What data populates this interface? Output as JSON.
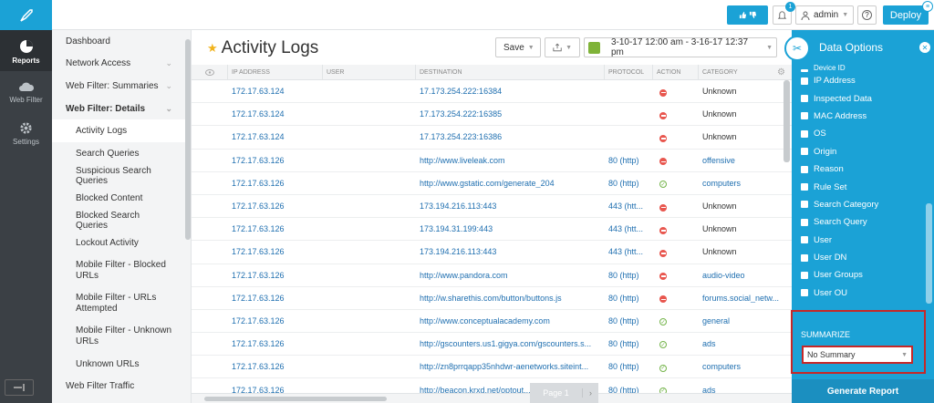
{
  "rail": {
    "items": [
      {
        "label": "Reports",
        "icon": "pie-chart-icon"
      },
      {
        "label": "Web Filter",
        "icon": "cloud-icon"
      },
      {
        "label": "Settings",
        "icon": "gear-icon"
      }
    ]
  },
  "topbar": {
    "notifications_count": "1",
    "user": "admin",
    "help": "?",
    "deploy": "Deploy"
  },
  "nav": {
    "items": [
      {
        "label": "Dashboard",
        "type": "top"
      },
      {
        "label": "Network Access",
        "type": "top",
        "chevron": true
      },
      {
        "label": "Web Filter: Summaries",
        "type": "top",
        "chevron": true
      },
      {
        "label": "Web Filter: Details",
        "type": "top-bold",
        "chevron": true
      },
      {
        "label": "Activity Logs",
        "type": "sub-active"
      },
      {
        "label": "Search Queries",
        "type": "sub"
      },
      {
        "label": "Suspicious Search Queries",
        "type": "sub"
      },
      {
        "label": "Blocked Content",
        "type": "sub"
      },
      {
        "label": "Blocked Search Queries",
        "type": "sub"
      },
      {
        "label": "Lockout Activity",
        "type": "sub"
      },
      {
        "label": "Mobile Filter - Blocked URLs",
        "type": "sub-two"
      },
      {
        "label": "Mobile Filter - URLs Attempted",
        "type": "sub-two"
      },
      {
        "label": "Mobile Filter - Unknown URLs",
        "type": "sub-two"
      },
      {
        "label": "Unknown URLs",
        "type": "sub"
      },
      {
        "label": "Web Filter Traffic",
        "type": "top"
      }
    ]
  },
  "main": {
    "title": "Activity Logs",
    "save": "Save",
    "date_range": "3-10-17 12:00 am - 3-16-17 12:37 pm",
    "columns": [
      "IP ADDRESS",
      "USER",
      "DESTINATION",
      "PROTOCOL",
      "ACTION",
      "CATEGORY"
    ],
    "rows": [
      {
        "ip": "172.17.63.124",
        "user": "",
        "dest": "17.173.254.222:16384",
        "proto": "",
        "action": "blocked",
        "cat": "Unknown"
      },
      {
        "ip": "172.17.63.124",
        "user": "",
        "dest": "17.173.254.222:16385",
        "proto": "",
        "action": "blocked",
        "cat": "Unknown"
      },
      {
        "ip": "172.17.63.124",
        "user": "",
        "dest": "17.173.254.223:16386",
        "proto": "",
        "action": "blocked",
        "cat": "Unknown"
      },
      {
        "ip": "172.17.63.126",
        "user": "",
        "dest": "http://www.liveleak.com",
        "proto": "80 (http)",
        "action": "blocked",
        "cat": "offensive"
      },
      {
        "ip": "172.17.63.126",
        "user": "",
        "dest": "http://www.gstatic.com/generate_204",
        "proto": "80 (http)",
        "action": "allowed",
        "cat": "computers"
      },
      {
        "ip": "172.17.63.126",
        "user": "",
        "dest": "173.194.216.113:443",
        "proto": "443 (htt...",
        "action": "blocked",
        "cat": "Unknown"
      },
      {
        "ip": "172.17.63.126",
        "user": "",
        "dest": "173.194.31.199:443",
        "proto": "443 (htt...",
        "action": "blocked",
        "cat": "Unknown"
      },
      {
        "ip": "172.17.63.126",
        "user": "",
        "dest": "173.194.216.113:443",
        "proto": "443 (htt...",
        "action": "blocked",
        "cat": "Unknown"
      },
      {
        "ip": "172.17.63.126",
        "user": "",
        "dest": "http://www.pandora.com",
        "proto": "80 (http)",
        "action": "blocked",
        "cat": "audio-video"
      },
      {
        "ip": "172.17.63.126",
        "user": "",
        "dest": "http://w.sharethis.com/button/buttons.js",
        "proto": "80 (http)",
        "action": "blocked",
        "cat": "forums.social_netw..."
      },
      {
        "ip": "172.17.63.126",
        "user": "",
        "dest": "http://www.conceptualacademy.com",
        "proto": "80 (http)",
        "action": "allowed",
        "cat": "general"
      },
      {
        "ip": "172.17.63.126",
        "user": "",
        "dest": "http://gscounters.us1.gigya.com/gscounters.s...",
        "proto": "80 (http)",
        "action": "allowed",
        "cat": "ads"
      },
      {
        "ip": "172.17.63.126",
        "user": "",
        "dest": "http://zn8prrqapp35nhdwr-aenetworks.siteint...",
        "proto": "80 (http)",
        "action": "allowed",
        "cat": "computers"
      },
      {
        "ip": "172.17.63.126",
        "user": "",
        "dest": "http://beacon.krxd.net/optout...",
        "proto": "80 (http)",
        "action": "allowed",
        "cat": "ads"
      }
    ],
    "pager": "Page 1"
  },
  "panel": {
    "title": "Data Options",
    "cut_item": "Device ID",
    "options": [
      "IP Address",
      "Inspected Data",
      "MAC Address",
      "OS",
      "Origin",
      "Reason",
      "Rule Set",
      "Search Category",
      "Search Query",
      "User",
      "User DN",
      "User Groups",
      "User OU"
    ],
    "summarize_label": "SUMMARIZE",
    "summarize_value": "No Summary",
    "generate": "Generate Report"
  }
}
